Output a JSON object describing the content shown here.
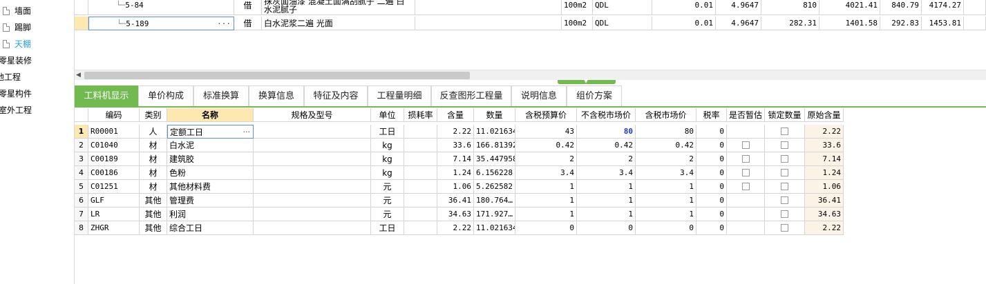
{
  "tree": {
    "items": [
      {
        "label": "墙面",
        "icon": "document-icon",
        "active": false
      },
      {
        "label": "踢脚",
        "icon": "document-icon",
        "active": false
      },
      {
        "label": "天棚",
        "icon": "document-icon",
        "active": true
      },
      {
        "label": "零星装修",
        "icon": "",
        "active": false
      },
      {
        "label": "地工程",
        "icon": "",
        "active": false
      },
      {
        "label": "零星构件",
        "icon": "",
        "active": false
      },
      {
        "label": "室外工程",
        "icon": "",
        "active": false
      }
    ]
  },
  "upper_rows": [
    {
      "code": "5-84",
      "type": "借",
      "name_line1": "抹灰面油漆 混凝土面满刮腻子 二遍 白",
      "name_line2": "水泥腻子",
      "unit": "100m2",
      "cat": "QDL",
      "qty": "0.01",
      "qty2": "4.9647",
      "price": "810",
      "total": "4021.41",
      "v1": "840.79",
      "v2": "4174.27"
    },
    {
      "code": "5-189",
      "type": "借",
      "name_line1": "白水泥浆二遍 光面",
      "name_line2": "",
      "unit": "100m2",
      "cat": "QDL",
      "qty": "0.01",
      "qty2": "4.9647",
      "price": "282.31",
      "total": "1401.58",
      "v1": "292.83",
      "v2": "1453.81"
    }
  ],
  "edit_dots": "···",
  "tabs": [
    {
      "label": "工料机显示",
      "active": true
    },
    {
      "label": "单价构成",
      "active": false
    },
    {
      "label": "标准换算",
      "active": false
    },
    {
      "label": "换算信息",
      "active": false
    },
    {
      "label": "特征及内容",
      "active": false
    },
    {
      "label": "工程量明细",
      "active": false
    },
    {
      "label": "反查图形工程量",
      "active": false
    },
    {
      "label": "说明信息",
      "active": false
    },
    {
      "label": "组价方案",
      "active": false
    }
  ],
  "columns": [
    "编码",
    "类别",
    "名称",
    "规格及型号",
    "单位",
    "损耗率",
    "含量",
    "数量",
    "含税预算价",
    "不含税市场价",
    "含税市场价",
    "税率",
    "是否暂估",
    "锁定数量",
    "原始含量"
  ],
  "rows": [
    {
      "num": "1",
      "code": "R00001",
      "type": "人",
      "name": "定额工日",
      "spec": "",
      "unit": "工日",
      "loss": "",
      "content": "2.22",
      "qty": "11.021634",
      "budget": "43",
      "market": "80",
      "market_tax": "80",
      "tax": "0",
      "est": false,
      "lock": true,
      "orig": "2.22"
    },
    {
      "num": "2",
      "code": "C01040",
      "type": "材",
      "name": "白水泥",
      "spec": "",
      "unit": "kg",
      "loss": "",
      "content": "33.6",
      "qty": "166.81392",
      "budget": "0.42",
      "market": "0.42",
      "market_tax": "0.42",
      "tax": "0",
      "est": true,
      "lock": true,
      "orig": "33.6"
    },
    {
      "num": "3",
      "code": "C00189",
      "type": "材",
      "name": "建筑胶",
      "spec": "",
      "unit": "kg",
      "loss": "",
      "content": "7.14",
      "qty": "35.447958",
      "budget": "2",
      "market": "2",
      "market_tax": "2",
      "tax": "0",
      "est": true,
      "lock": true,
      "orig": "7.14"
    },
    {
      "num": "4",
      "code": "C00186",
      "type": "材",
      "name": "色粉",
      "spec": "",
      "unit": "kg",
      "loss": "",
      "content": "1.24",
      "qty": "6.156228",
      "budget": "3.4",
      "market": "3.4",
      "market_tax": "3.4",
      "tax": "0",
      "est": true,
      "lock": true,
      "orig": "1.24"
    },
    {
      "num": "5",
      "code": "C01251",
      "type": "材",
      "name": "其他材料费",
      "spec": "",
      "unit": "元",
      "loss": "",
      "content": "1.06",
      "qty": "5.262582",
      "budget": "1",
      "market": "1",
      "market_tax": "1",
      "tax": "0",
      "est": true,
      "lock": true,
      "orig": "1.06"
    },
    {
      "num": "6",
      "code": "GLF",
      "type": "其他",
      "name": "管理费",
      "spec": "",
      "unit": "元",
      "loss": "",
      "content": "36.41",
      "qty": "180.764…",
      "budget": "1",
      "market": "1",
      "market_tax": "1",
      "tax": "0",
      "est": false,
      "lock": true,
      "orig": "36.41"
    },
    {
      "num": "7",
      "code": "LR",
      "type": "其他",
      "name": "利润",
      "spec": "",
      "unit": "元",
      "loss": "",
      "content": "34.63",
      "qty": "171.927…",
      "budget": "1",
      "market": "1",
      "market_tax": "1",
      "tax": "0",
      "est": false,
      "lock": true,
      "orig": "34.63"
    },
    {
      "num": "8",
      "code": "ZHGR",
      "type": "其他",
      "name": "综合工日",
      "spec": "",
      "unit": "工日",
      "loss": "",
      "content": "2.22",
      "qty": "11.021634",
      "budget": "0",
      "market": "0",
      "market_tax": "0",
      "tax": "0",
      "est": false,
      "lock": true,
      "orig": "2.22"
    }
  ],
  "colors": {
    "accent": "#72b94f",
    "highlight": "#fde8b0",
    "link_blue": "#1c37c8",
    "active_tree": "#2a9fd8"
  }
}
